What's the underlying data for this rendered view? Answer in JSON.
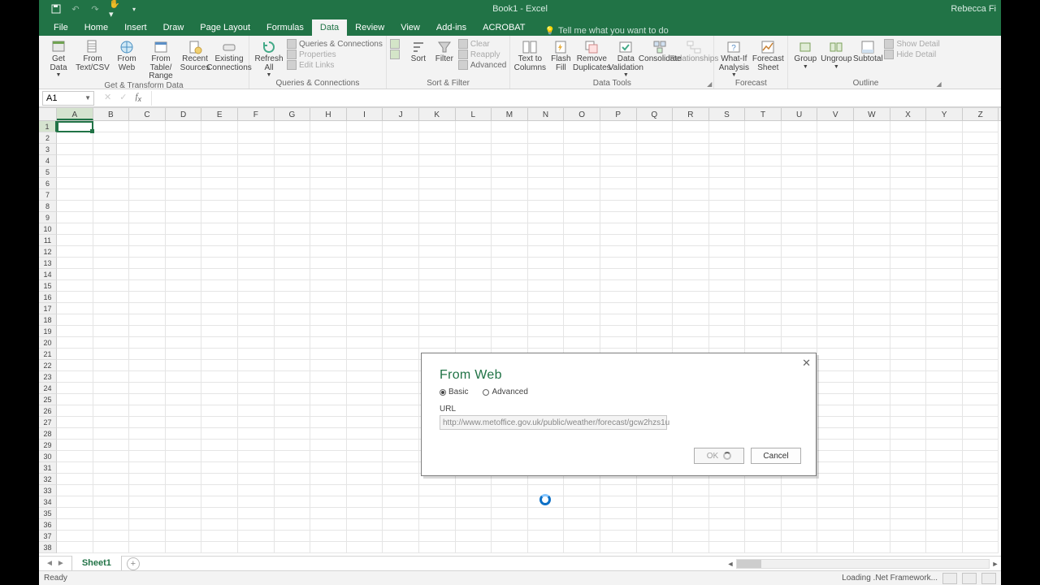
{
  "title": "Book1 - Excel",
  "user": "Rebecca Fi",
  "tabs": [
    "File",
    "Home",
    "Insert",
    "Draw",
    "Page Layout",
    "Formulas",
    "Data",
    "Review",
    "View",
    "Add-ins",
    "ACROBAT"
  ],
  "active_tab": "Data",
  "tellme": "Tell me what you want to do",
  "ribbon": {
    "get_transform": {
      "label": "Get & Transform Data",
      "get_data": "Get Data",
      "from_textcsv": "From Text/CSV",
      "from_web": "From Web",
      "from_tablerange": "From Table/ Range",
      "recent_sources": "Recent Sources",
      "existing_conn": "Existing Connections"
    },
    "queries": {
      "label": "Queries & Connections",
      "refresh_all": "Refresh All",
      "queries_conn": "Queries & Connections",
      "properties": "Properties",
      "edit_links": "Edit Links"
    },
    "sort_filter": {
      "label": "Sort & Filter",
      "sort": "Sort",
      "filter": "Filter",
      "clear": "Clear",
      "reapply": "Reapply",
      "advanced": "Advanced"
    },
    "data_tools": {
      "label": "Data Tools",
      "text_to_columns": "Text to Columns",
      "flash_fill": "Flash Fill",
      "remove_dup": "Remove Duplicates",
      "data_valid": "Data Validation",
      "consolidate": "Consolidate",
      "relationships": "Relationships"
    },
    "forecast": {
      "label": "Forecast",
      "whatif": "What-If Analysis",
      "forecast_sheet": "Forecast Sheet"
    },
    "outline": {
      "label": "Outline",
      "group": "Group",
      "ungroup": "Ungroup",
      "subtotal": "Subtotal",
      "show_detail": "Show Detail",
      "hide_detail": "Hide Detail"
    }
  },
  "namebox": "A1",
  "columns": [
    "A",
    "B",
    "C",
    "D",
    "E",
    "F",
    "G",
    "H",
    "I",
    "J",
    "K",
    "L",
    "M",
    "N",
    "O",
    "P",
    "Q",
    "R",
    "S",
    "T",
    "U",
    "V",
    "W",
    "X",
    "Y",
    "Z"
  ],
  "row_count": 38,
  "sheet": {
    "name": "Sheet1"
  },
  "status": {
    "ready": "Ready",
    "loading": "Loading .Net Framework..."
  },
  "dialog": {
    "title": "From Web",
    "basic": "Basic",
    "advanced": "Advanced",
    "url_label": "URL",
    "url_value": "http://www.metoffice.gov.uk/public/weather/forecast/gcw2hzs1u",
    "ok": "OK",
    "cancel": "Cancel"
  }
}
